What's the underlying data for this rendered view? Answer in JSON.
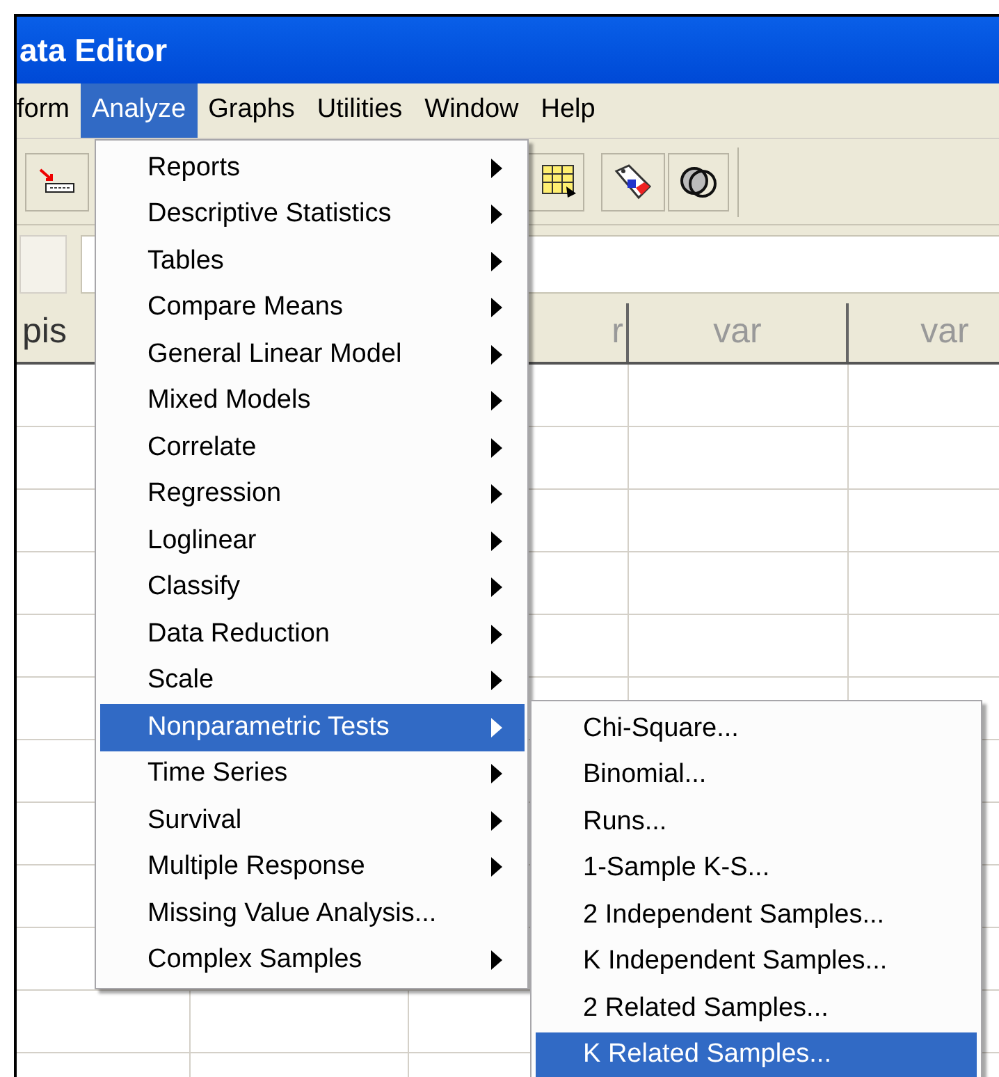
{
  "window": {
    "title": "ata Editor"
  },
  "menu_bar": [
    {
      "label": "form",
      "selected": false
    },
    {
      "label": "Analyze",
      "selected": true
    },
    {
      "label": "Graphs",
      "selected": false
    },
    {
      "label": "Utilities",
      "selected": false
    },
    {
      "label": "Window",
      "selected": false
    },
    {
      "label": "Help",
      "selected": false
    }
  ],
  "columns": [
    {
      "label": "pis"
    },
    {
      "label": "r"
    },
    {
      "label": "var"
    },
    {
      "label": "var"
    }
  ],
  "analyze_menu": [
    {
      "label": "Reports",
      "submenu": true,
      "selected": false
    },
    {
      "label": "Descriptive Statistics",
      "submenu": true,
      "selected": false
    },
    {
      "label": "Tables",
      "submenu": true,
      "selected": false
    },
    {
      "label": "Compare Means",
      "submenu": true,
      "selected": false
    },
    {
      "label": "General Linear Model",
      "submenu": true,
      "selected": false
    },
    {
      "label": "Mixed Models",
      "submenu": true,
      "selected": false
    },
    {
      "label": "Correlate",
      "submenu": true,
      "selected": false
    },
    {
      "label": "Regression",
      "submenu": true,
      "selected": false
    },
    {
      "label": "Loglinear",
      "submenu": true,
      "selected": false
    },
    {
      "label": "Classify",
      "submenu": true,
      "selected": false
    },
    {
      "label": "Data Reduction",
      "submenu": true,
      "selected": false
    },
    {
      "label": "Scale",
      "submenu": true,
      "selected": false
    },
    {
      "label": "Nonparametric Tests",
      "submenu": true,
      "selected": true
    },
    {
      "label": "Time Series",
      "submenu": true,
      "selected": false
    },
    {
      "label": "Survival",
      "submenu": true,
      "selected": false
    },
    {
      "label": "Multiple Response",
      "submenu": true,
      "selected": false
    },
    {
      "label": "Missing Value Analysis...",
      "submenu": false,
      "selected": false
    },
    {
      "label": "Complex Samples",
      "submenu": true,
      "selected": false
    }
  ],
  "nonparametric_submenu": [
    {
      "label": "Chi-Square...",
      "selected": false
    },
    {
      "label": "Binomial...",
      "selected": false
    },
    {
      "label": "Runs...",
      "selected": false
    },
    {
      "label": "1-Sample K-S...",
      "selected": false
    },
    {
      "label": "2 Independent Samples...",
      "selected": false
    },
    {
      "label": "K Independent Samples...",
      "selected": false
    },
    {
      "label": "2 Related Samples...",
      "selected": false
    },
    {
      "label": "K Related Samples...",
      "selected": true
    }
  ]
}
